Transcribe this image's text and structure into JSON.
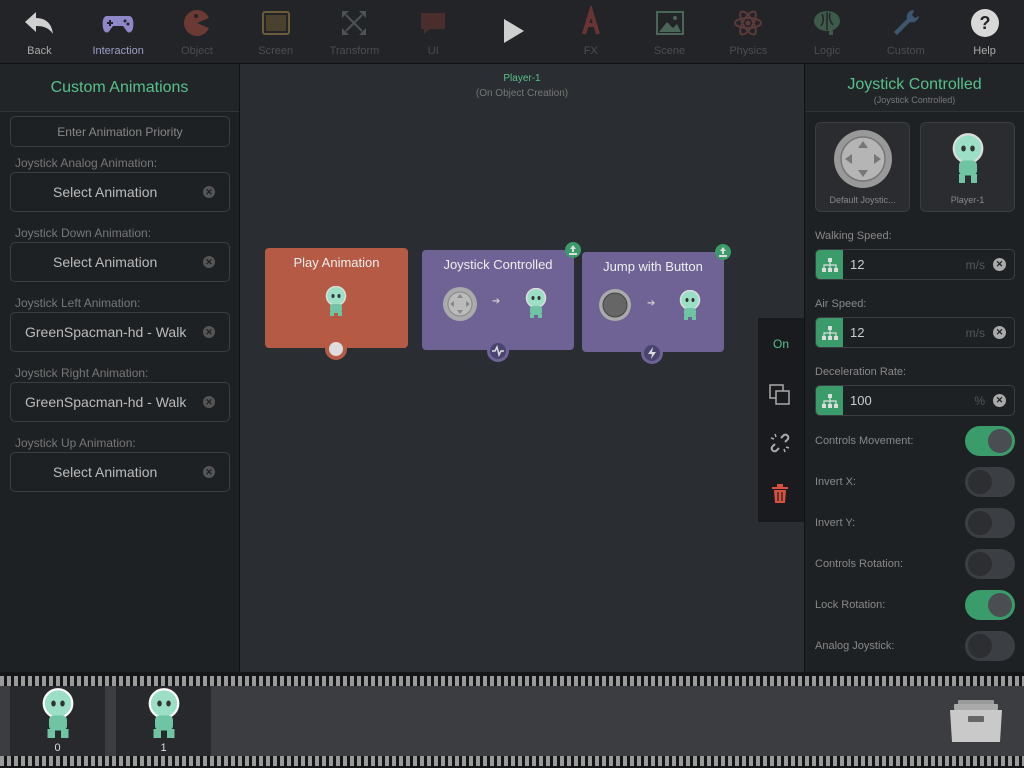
{
  "toolbar": {
    "items": [
      {
        "label": "Back",
        "icon": "back-arrow-icon",
        "state": "bright"
      },
      {
        "label": "Interaction",
        "icon": "gamepad-icon",
        "state": "active"
      },
      {
        "label": "Object",
        "icon": "pacman-icon",
        "state": "dim"
      },
      {
        "label": "Screen",
        "icon": "tablet-icon",
        "state": "dim"
      },
      {
        "label": "Transform",
        "icon": "expand-icon",
        "state": "dim"
      },
      {
        "label": "UI",
        "icon": "speech-bubble-icon",
        "state": "dim"
      },
      {
        "label": "",
        "icon": "play-icon",
        "state": "bright"
      },
      {
        "label": "FX",
        "icon": "fx-icon",
        "state": "dim"
      },
      {
        "label": "Scene",
        "icon": "image-icon",
        "state": "dim"
      },
      {
        "label": "Physics",
        "icon": "atom-icon",
        "state": "dim"
      },
      {
        "label": "Logic",
        "icon": "brain-icon",
        "state": "dim"
      },
      {
        "label": "Custom",
        "icon": "wrench-icon",
        "state": "dim"
      },
      {
        "label": "Help",
        "icon": "help-icon",
        "state": "bright"
      }
    ]
  },
  "left": {
    "title": "Custom Animations",
    "priority_placeholder": "Enter Animation Priority",
    "fields": [
      {
        "label": "Joystick Analog Animation:",
        "value": "Select Animation",
        "is_placeholder": true
      },
      {
        "label": "Joystick Down Animation:",
        "value": "Select Animation",
        "is_placeholder": true
      },
      {
        "label": "Joystick Left Animation:",
        "value": "GreenSpacman-hd - Walk",
        "is_placeholder": false
      },
      {
        "label": "Joystick Right Animation:",
        "value": "GreenSpacman-hd - Walk",
        "is_placeholder": false
      },
      {
        "label": "Joystick Up Animation:",
        "value": "Select Animation",
        "is_placeholder": true
      }
    ]
  },
  "canvas": {
    "object_name": "Player-1",
    "object_subtitle": "(On Object Creation)",
    "nodes": [
      {
        "title": "Play Animation",
        "color": "#b55a44"
      },
      {
        "title": "Joystick Controlled",
        "color": "#6f6395"
      },
      {
        "title": "Jump with Button",
        "color": "#6f6395"
      }
    ],
    "actions": {
      "on_label": "On"
    }
  },
  "right": {
    "title": "Joystick Controlled",
    "subtitle": "(Joystick Controlled)",
    "thumbs": [
      {
        "label": "Default Joystic..."
      },
      {
        "label": "Player-1"
      }
    ],
    "walking_speed": {
      "label": "Walking Speed:",
      "value": "12",
      "unit": "m/s"
    },
    "air_speed": {
      "label": "Air Speed:",
      "value": "12",
      "unit": "m/s"
    },
    "deceleration": {
      "label": "Deceleration Rate:",
      "value": "100",
      "unit": "%"
    },
    "toggles": [
      {
        "label": "Controls Movement:",
        "on": true
      },
      {
        "label": "Invert X:",
        "on": false
      },
      {
        "label": "Invert Y:",
        "on": false
      },
      {
        "label": "Controls Rotation:",
        "on": false
      },
      {
        "label": "Lock Rotation:",
        "on": true
      },
      {
        "label": "Analog Joystick:",
        "on": false
      }
    ]
  },
  "filmstrip": {
    "frames": [
      {
        "number": "0"
      },
      {
        "number": "1"
      }
    ]
  },
  "colors": {
    "accent": "#57c08c",
    "green": "#3a9c6a",
    "node_red": "#b55a44",
    "node_purple": "#6f6395"
  }
}
